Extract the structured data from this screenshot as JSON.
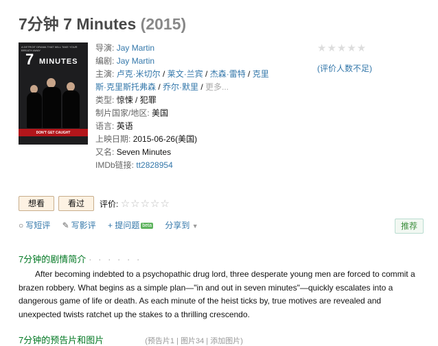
{
  "title": {
    "main": "7分钟 7 Minutes",
    "year": "(2015)"
  },
  "poster": {
    "tagline": "A DETROIT DRAMA THAT WILL TAKE YOUR BREATH AWAY",
    "num": "7",
    "word": "MINUTES",
    "bottom": "DON'T GET CAUGHT"
  },
  "info": {
    "director_label": "导演:",
    "director": "Jay Martin",
    "writer_label": "编剧:",
    "writer": "Jay Martin",
    "cast_label": "主演:",
    "cast": [
      "卢克·米切尔",
      "莱文·兰宾",
      "杰森·雷特",
      "克里斯·克里斯托弗森",
      "乔尔·默里"
    ],
    "cast_line1": [
      "卢克·米切尔",
      "莱文·兰宾",
      "杰森·雷特",
      "克里"
    ],
    "cast_line2": [
      "斯·克里斯托弗森",
      "乔尔·默里"
    ],
    "more": "更多...",
    "genre_label": "类型:",
    "genres": "惊悚 / 犯罪",
    "country_label": "制片国家/地区:",
    "country": "美国",
    "language_label": "语言:",
    "language": "英语",
    "release_label": "上映日期:",
    "release": "2015-06-26(美国)",
    "aka_label": "又名:",
    "aka": "Seven Minutes",
    "imdb_label": "IMDb链接:",
    "imdb": "tt2828954"
  },
  "rating": {
    "stars": "★★★★★",
    "note": "(评价人数不足)"
  },
  "buttons": {
    "want": "想看",
    "seen": "看过",
    "rate_label": "评价:",
    "rate_stars": "☆☆☆☆☆"
  },
  "actions": {
    "short_review": "写短评",
    "review": "写影评",
    "ask": "+ 提问题",
    "beta": "beta",
    "share": "分享到",
    "recommend": "推荐"
  },
  "summary": {
    "heading": "7分钟的剧情简介",
    "dots": "· · · · · ·",
    "text": "After becoming indebted to a psychopathic drug lord, three desperate young men are forced to commit a brazen robbery. What begins as a simple plan—\"in and out in seven minutes\"—quickly escalates into a dangerous game of life or death. As each minute of the heist ticks by, true motives are revealed and unexpected twists ratchet up the stakes to a thrilling crescendo."
  },
  "next_section": {
    "heading": "7分钟的预告片和图片",
    "rest": "(预告片1 | 图片34 | 添加图片)"
  },
  "colors": {
    "link": "#3377aa",
    "section": "#007722",
    "button_bg": "#fdf2e3"
  }
}
